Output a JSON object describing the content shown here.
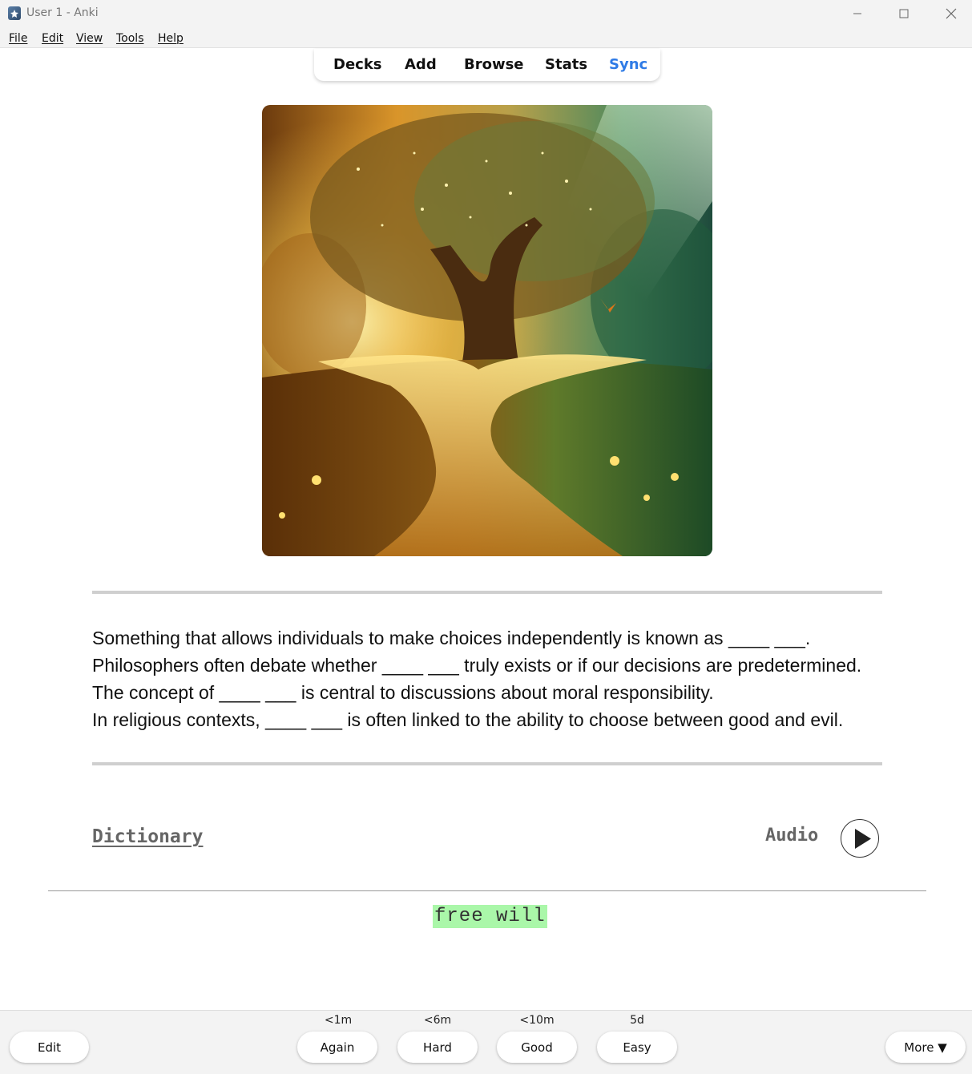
{
  "window": {
    "title": "User 1 - Anki",
    "controls": [
      "minimize-icon",
      "maximize-icon",
      "close-icon"
    ]
  },
  "menu": {
    "items": [
      "File",
      "Edit",
      "View",
      "Tools",
      "Help"
    ]
  },
  "toolbar": {
    "items": [
      "Decks",
      "Add",
      "Browse",
      "Stats",
      "Sync"
    ],
    "sync_color": "#2f7be6"
  },
  "card": {
    "sentences": [
      "Something that allows individuals to make choices independently is known as ____ ___.",
      "Philosophers often debate whether ____ ___ truly exists or if our decisions are predetermined.",
      "The concept of ____ ___ is central to discussions about moral responsibility.",
      "In religious contexts, ____ ___ is often linked to the ability to choose between good and evil."
    ],
    "dictionary_label": "Dictionary",
    "audio_label": "Audio",
    "answer": "free will",
    "answer_highlight": "#aaf7a9"
  },
  "review": {
    "edit_label": "Edit",
    "more_label": "More ▼",
    "buttons": [
      {
        "label": "Again",
        "interval": "<1m"
      },
      {
        "label": "Hard",
        "interval": "<6m"
      },
      {
        "label": "Good",
        "interval": "<10m"
      },
      {
        "label": "Easy",
        "interval": "5d"
      }
    ]
  }
}
